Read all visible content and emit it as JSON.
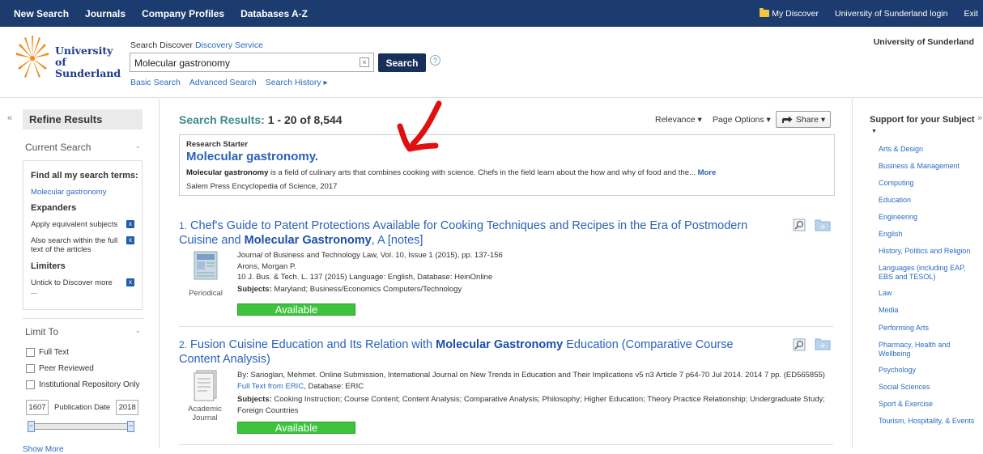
{
  "topnav": {
    "items": [
      "New Search",
      "Journals",
      "Company Profiles",
      "Databases A-Z"
    ],
    "my_discover": "My Discover",
    "login": "University of Sunderland login",
    "exit": "Exit"
  },
  "header": {
    "logo_text": "University of Sunderland",
    "search_label": "Search Discover",
    "search_service": "Discovery Service",
    "search_value": "Molecular gastronomy",
    "search_button": "Search",
    "help": "?",
    "links": [
      "Basic Search",
      "Advanced Search",
      "Search History ▸"
    ],
    "institution": "University of Sunderland"
  },
  "left": {
    "refine": "Refine Results",
    "current_search": "Current Search",
    "find_all": "Find all my search terms:",
    "term": "Molecular gastronomy",
    "expanders": "Expanders",
    "exp1": "Apply equivalent subjects",
    "exp2": "Also search within the full text of the articles",
    "limiters": "Limiters",
    "lim1": "Untick to Discover more ...",
    "limit_to": "Limit To",
    "cb1": "Full Text",
    "cb2": "Peer Reviewed",
    "cb3": "Institutional Repository Only",
    "pub_from": "1607",
    "pub_label": "Publication Date",
    "pub_to": "2018",
    "show_more": "Show More"
  },
  "results": {
    "heading": "Search Results:",
    "count": "1 - 20 of 8,544",
    "relevance": "Relevance ▾",
    "page_options": "Page Options ▾",
    "share": "Share ▾",
    "starter": {
      "label": "Research Starter",
      "title": "Molecular gastronomy.",
      "desc_bold": "Molecular gastronomy",
      "desc_rest": " is a field of culinary arts that combines cooking with science. Chefs in the field learn about the how and why of food and the...",
      "more": "More",
      "source": "Salem Press Encyclopedia of Science, 2017"
    },
    "items": [
      {
        "num": "1.",
        "title_a": "Chef's Guide to Patent Protections Available for Cooking Techniques and Recipes in the Era of Postmodern Cuisine and ",
        "title_b": "Molecular Gastronomy",
        "title_c": ", A [notes]",
        "line1": "Journal of Business and Technology Law, Vol. 10, Issue 1 (2015), pp. 137-156",
        "line2": "Arons, Morgan P.",
        "line3": "10 J. Bus. & Tech. L. 137 (2015) Language: English, Database: HeinOnline",
        "subjects_label": "Subjects:",
        "subjects": "Maryland; Business/Economics Computers/Technology",
        "type": "Periodical",
        "avail": "Available"
      },
      {
        "num": "2.",
        "title_a": "Fusion Cuisine Education and Its Relation with ",
        "title_b": "Molecular Gastronomy",
        "title_c": " Education (Comparative Course Content Analysis)",
        "line1": "By: Sarioglan, Mehmet. Online Submission, International Journal on New Trends in Education and Their Implications v5 n3 Article 7 p64-70 Jul 2014. 2014 7 pp. (ED565855)",
        "fulltext": "Full Text from ERIC",
        "database": ", Database: ERIC",
        "subjects_label": "Subjects:",
        "subjects": "Cooking Instruction; Course Content; Content Analysis; Comparative Analysis; Philosophy; Higher Education; Theory Practice Relationship; Undergraduate Study; Foreign Countries",
        "type": "Academic Journal",
        "avail": "Available"
      }
    ]
  },
  "right": {
    "heading": "Support for your Subject",
    "subjects": [
      "Arts & Design",
      "Business & Management",
      "Computing",
      "Education",
      "Engineering",
      "English",
      "History, Politics and Religion",
      "Languages (including EAP, EBS and TESOL)",
      "Law",
      "Media",
      "Performing Arts",
      "Pharmacy, Health and Wellbeing",
      "Psychology",
      "Social Sciences",
      "Sport & Exercise",
      "Tourism, Hospitality, & Events"
    ]
  },
  "colors": {
    "topbar": "#1c3b6e",
    "link": "#2a62b9",
    "results_heading": "#3c8c8c",
    "available": "#3cc53c",
    "annotation_arrow": "#e01010"
  }
}
